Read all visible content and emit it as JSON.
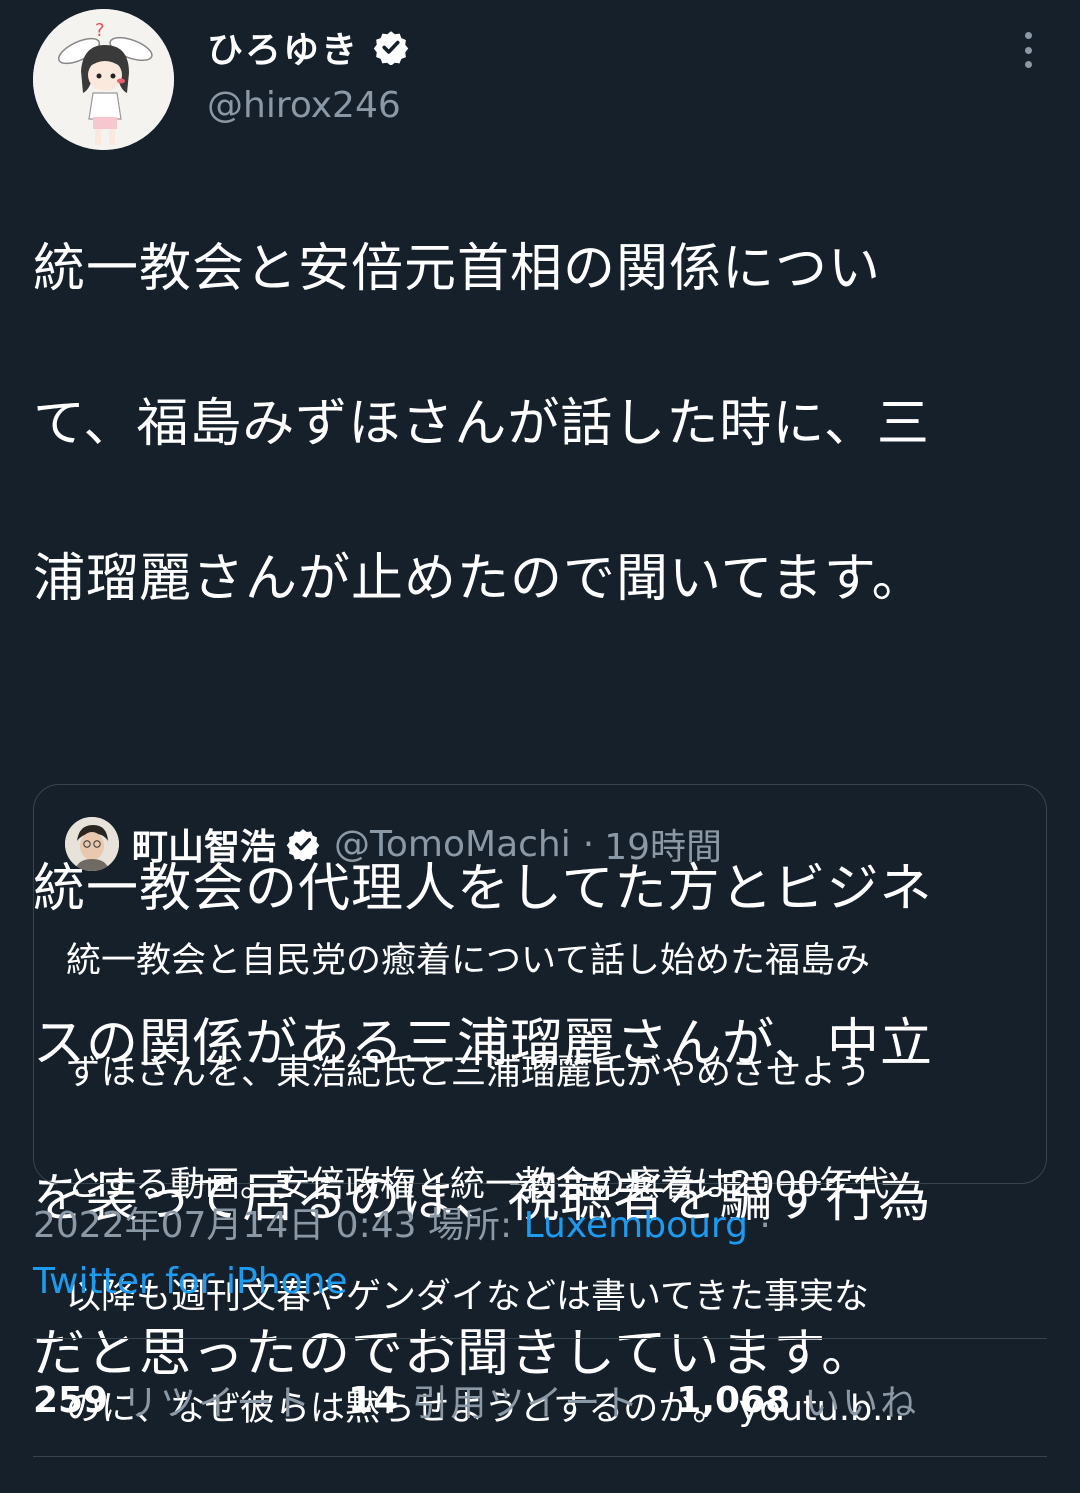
{
  "author": {
    "display_name": "ひろゆき",
    "handle": "@hirox246",
    "verified_icon": "verified-badge-icon"
  },
  "tweet": {
    "text": "統一教会と安倍元首相の関係について、福島みずほさんが話した時に、三浦瑠麗さんが止めたので聞いてます。\n\n統一教会の代理人をしてた方とビジネスの関係がある三浦瑠麗さんが、中立を装って居るのは、視聴者を騙す行為だと思ったのでお聞きしています。",
    "lines": [
      "統一教会と安倍元首相の関係につい",
      "て、福島みずほさんが話した時に、三",
      "浦瑠麗さんが止めたので聞いてます。",
      "",
      "統一教会の代理人をしてた方とビジネ",
      "スの関係がある三浦瑠麗さんが、中立",
      "を装って居るのは、視聴者を騙す行為",
      "だと思ったのでお聞きしています。"
    ]
  },
  "quote": {
    "display_name": "町山智浩",
    "handle": "@TomoMachi",
    "separator": "·",
    "time": "19時間",
    "lines": [
      "統一教会と自民党の癒着について話し始めた福島み",
      "ずほさんを、東浩紀氏と三浦瑠麗氏がやめさせよう",
      "とする動画。安倍政権と統一教会の癒着は2000年代",
      "以降も週刊文春やゲンダイなどは書いてきた事実な",
      "のに、なぜ彼らは黙らせようとするのか。 youtu.b..."
    ]
  },
  "meta": {
    "datetime": "2022年07月14日 0:43",
    "place_label": "場所:",
    "place": "Luxembourg",
    "separator": "·",
    "source": "Twitter for iPhone"
  },
  "stats": {
    "retweets_count": "259",
    "retweets_label": "リツイート",
    "quotes_count": "14",
    "quotes_label": "引用ツイート",
    "likes_count": "1,068",
    "likes_label": "いいね"
  },
  "colors": {
    "background": "#15202b",
    "text": "#ffffff",
    "secondary": "#8b98a5",
    "link": "#1d9bf0",
    "border": "#38444d"
  }
}
